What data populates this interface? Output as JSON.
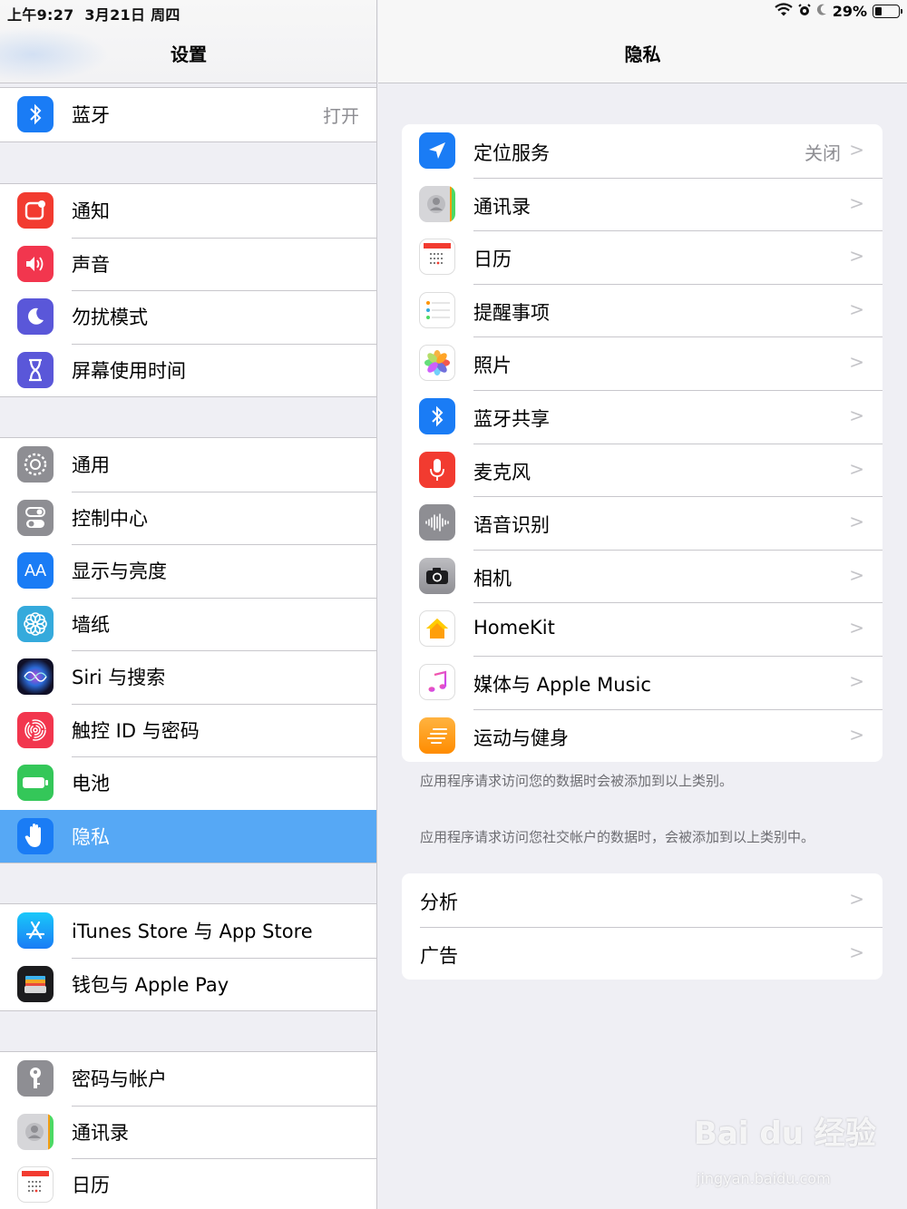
{
  "status": {
    "time": "上午9:27",
    "date": "3月21日 周四",
    "battery": "29%"
  },
  "left": {
    "title": "设置",
    "groups": [
      [
        {
          "label": "蓝牙",
          "value": "打开",
          "icon": "bluetooth-icon",
          "color": "#1a7cf5"
        }
      ],
      [
        {
          "label": "通知",
          "icon": "notifications-icon",
          "color": "#f23b30"
        },
        {
          "label": "声音",
          "icon": "speaker-icon",
          "color": "#f2364e"
        },
        {
          "label": "勿扰模式",
          "icon": "moon-icon",
          "color": "#5a57d9"
        },
        {
          "label": "屏幕使用时间",
          "icon": "hourglass-icon",
          "color": "#5a57d9"
        }
      ],
      [
        {
          "label": "通用",
          "icon": "gear-icon",
          "color": "#8e8e93"
        },
        {
          "label": "控制中心",
          "icon": "toggles-icon",
          "color": "#8e8e93"
        },
        {
          "label": "显示与亮度",
          "icon": "text-size-icon",
          "color": "#1a7cf5"
        },
        {
          "label": "墙纸",
          "icon": "flower-icon",
          "color": "#35aadc"
        },
        {
          "label": "Siri 与搜索",
          "icon": "siri-icon",
          "color": "#1c1c3a"
        },
        {
          "label": "触控 ID 与密码",
          "icon": "fingerprint-icon",
          "color": "#f2364e"
        },
        {
          "label": "电池",
          "icon": "battery-icon",
          "color": "#34c759"
        },
        {
          "label": "隐私",
          "icon": "hand-icon",
          "color": "#1a7cf5",
          "selected": true
        }
      ],
      [
        {
          "label": "iTunes Store 与 App Store",
          "icon": "app-store-icon",
          "color": "#1a8ef5"
        },
        {
          "label": "钱包与 Apple Pay",
          "icon": "wallet-icon",
          "color": "#1c1c1e"
        }
      ],
      [
        {
          "label": "密码与帐户",
          "icon": "key-icon",
          "color": "#8e8e93"
        },
        {
          "label": "通讯录",
          "icon": "contacts-icon",
          "color": "#c9c9cc"
        },
        {
          "label": "日历",
          "icon": "calendar-icon",
          "color": "#ffffff"
        }
      ]
    ]
  },
  "right": {
    "title": "隐私",
    "items": [
      {
        "label": "定位服务",
        "value": "关闭",
        "icon": "location-arrow-icon",
        "color": "#1a7cf5"
      },
      {
        "label": "通讯录",
        "icon": "contacts-icon",
        "color": "#c9c9cc"
      },
      {
        "label": "日历",
        "icon": "calendar-icon",
        "color": "#ffffff"
      },
      {
        "label": "提醒事项",
        "icon": "reminders-icon",
        "color": "#ffffff"
      },
      {
        "label": "照片",
        "icon": "photos-icon",
        "color": "#ffffff"
      },
      {
        "label": "蓝牙共享",
        "icon": "bluetooth-icon",
        "color": "#1a7cf5"
      },
      {
        "label": "麦克风",
        "icon": "microphone-icon",
        "color": "#f23b30"
      },
      {
        "label": "语音识别",
        "icon": "waveform-icon",
        "color": "#8e8e93"
      },
      {
        "label": "相机",
        "icon": "camera-icon",
        "color": "#8e8e93"
      },
      {
        "label": "HomeKit",
        "icon": "home-icon",
        "color": "#ffffff"
      },
      {
        "label": "媒体与 Apple Music",
        "icon": "music-note-icon",
        "color": "#ffffff"
      },
      {
        "label": "运动与健身",
        "icon": "motion-icon",
        "color": "#ff9500"
      }
    ],
    "footnote1": "应用程序请求访问您的数据时会被添加到以上类别。",
    "footnote2": "应用程序请求访问您社交帐户的数据时，会被添加到以上类别中。",
    "extra_items": [
      {
        "label": "分析"
      },
      {
        "label": "广告"
      }
    ]
  },
  "watermark": {
    "main": "Bai du 经验",
    "sub": "jingyan.baidu.com"
  }
}
